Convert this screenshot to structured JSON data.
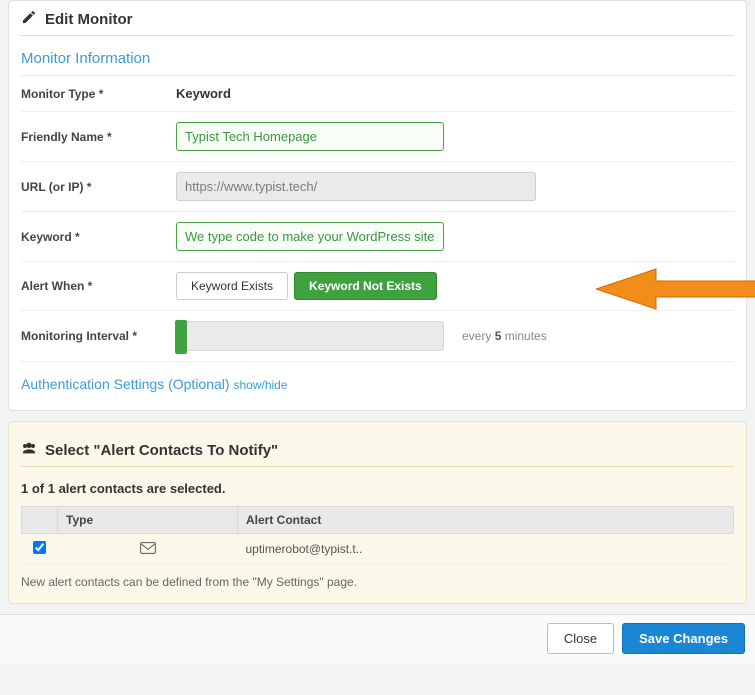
{
  "header": {
    "title": "Edit Monitor"
  },
  "monitor_info": {
    "section_title": "Monitor Information",
    "rows": {
      "type_label": "Monitor Type *",
      "type_value": "Keyword",
      "name_label": "Friendly Name *",
      "name_value": "Typist Tech Homepage",
      "url_label": "URL (or IP) *",
      "url_value": "https://www.typist.tech/",
      "keyword_label": "Keyword *",
      "keyword_value": "We type code to make your WordPress sites f",
      "alert_when_label": "Alert When *",
      "alert_option_exists": "Keyword Exists",
      "alert_option_not_exists": "Keyword Not Exists",
      "interval_label": "Monitoring Interval *",
      "interval_text_prefix": "every ",
      "interval_text_value": "5",
      "interval_text_suffix": " minutes"
    },
    "auth_label": "Authentication Settings (Optional)",
    "auth_toggle": "show/hide"
  },
  "contacts": {
    "section_title": "Select \"Alert Contacts To Notify\"",
    "selected_count_text": "1 of 1 alert contacts are selected.",
    "columns": {
      "type": "Type",
      "contact": "Alert Contact"
    },
    "rows": [
      {
        "checked": true,
        "type_icon": "mail",
        "contact": "uptimerobot@typist.t.."
      }
    ],
    "hint": "New alert contacts can be defined from the \"My Settings\" page."
  },
  "footer": {
    "close": "Close",
    "save": "Save Changes"
  }
}
